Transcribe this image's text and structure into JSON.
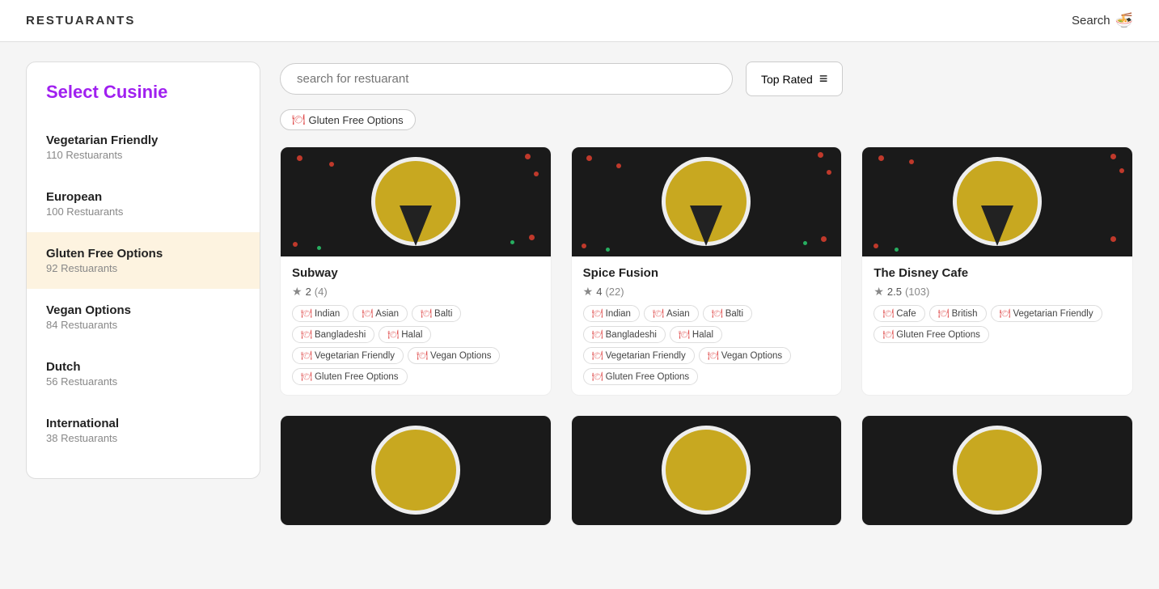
{
  "header": {
    "title": "RESTUARANTS",
    "search_label": "Search",
    "search_icon": "🍜"
  },
  "sidebar": {
    "heading": "Select Cusinie",
    "items": [
      {
        "name": "Vegetarian Friendly",
        "count": "110 Restuarants",
        "active": false
      },
      {
        "name": "European",
        "count": "100 Restuarants",
        "active": false
      },
      {
        "name": "Gluten Free Options",
        "count": "92 Restuarants",
        "active": true
      },
      {
        "name": "Vegan Options",
        "count": "84 Restuarants",
        "active": false
      },
      {
        "name": "Dutch",
        "count": "56 Restuarants",
        "active": false
      },
      {
        "name": "International",
        "count": "38 Restuarants",
        "active": false
      }
    ]
  },
  "search": {
    "placeholder": "search for restuarant"
  },
  "sort": {
    "label": "Top Rated",
    "icon": "≡"
  },
  "active_filter": {
    "label": "Gluten Free Options",
    "icon": "🍽"
  },
  "restaurants": [
    {
      "name": "Subway",
      "rating": "2",
      "rating_count": "(4)",
      "tags": [
        "Indian",
        "Asian",
        "Balti",
        "Bangladeshi",
        "Halal",
        "Vegetarian Friendly",
        "Vegan Options",
        "Gluten Free Options"
      ]
    },
    {
      "name": "Spice Fusion",
      "rating": "4",
      "rating_count": "(22)",
      "tags": [
        "Indian",
        "Asian",
        "Balti",
        "Bangladeshi",
        "Halal",
        "Vegetarian Friendly",
        "Vegan Options",
        "Gluten Free Options"
      ]
    },
    {
      "name": "The Disney Cafe",
      "rating": "2.5",
      "rating_count": "(103)",
      "tags": [
        "Cafe",
        "British",
        "Vegetarian Friendly",
        "Gluten Free Options"
      ]
    }
  ]
}
